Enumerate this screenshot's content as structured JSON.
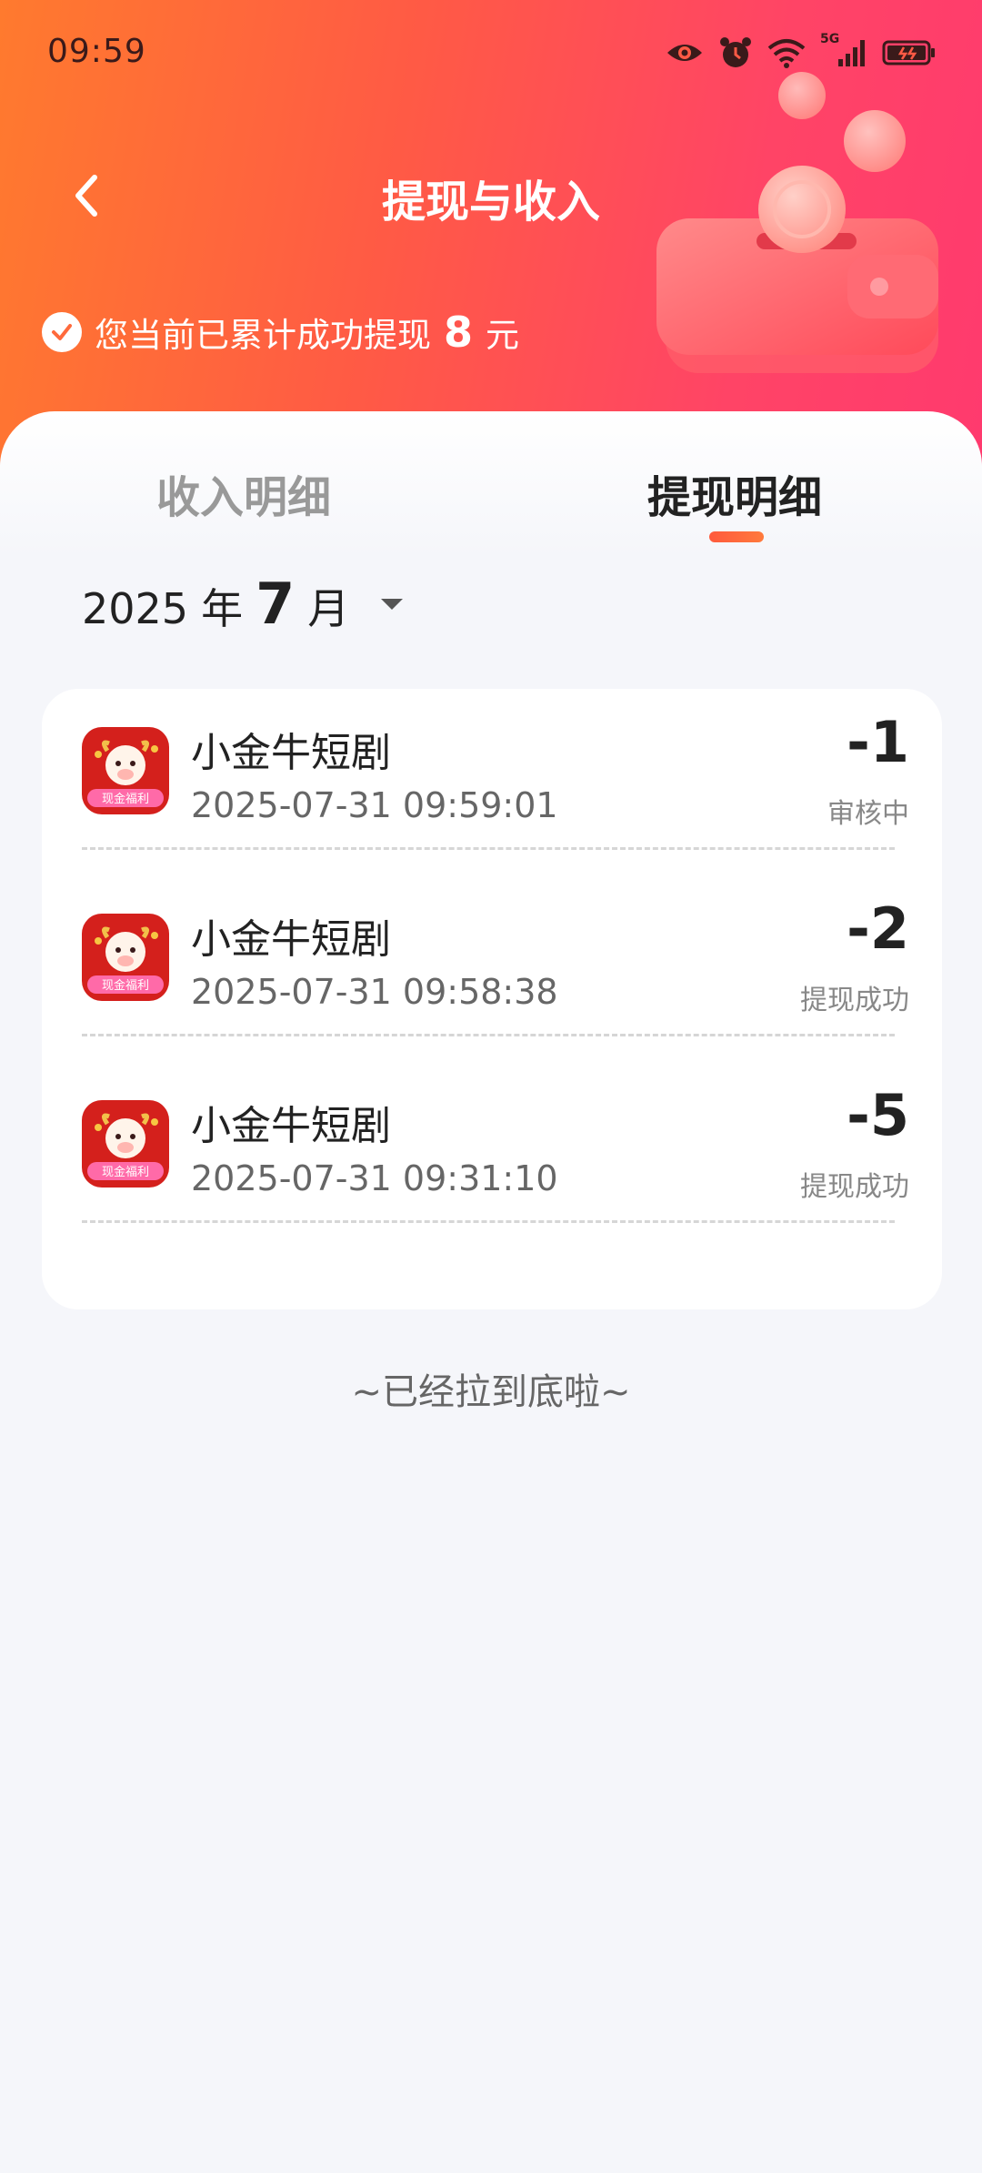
{
  "status_bar": {
    "time": "09:59",
    "network_label": "5G"
  },
  "header": {
    "title": "提现与收入",
    "summary_prefix": "您当前已累计成功提现",
    "summary_amount": "8",
    "summary_unit": "元"
  },
  "tabs": [
    {
      "label": "收入明细",
      "active": false
    },
    {
      "label": "提现明细",
      "active": true
    }
  ],
  "month_selector": {
    "year": "2025",
    "year_unit": "年",
    "month": "7",
    "month_unit": "月"
  },
  "records": [
    {
      "app_name": "小金牛短剧",
      "time": "2025-07-31 09:59:01",
      "amount": "-1",
      "status": "审核中",
      "icon_badge": "现金福利"
    },
    {
      "app_name": "小金牛短剧",
      "time": "2025-07-31 09:58:38",
      "amount": "-2",
      "status": "提现成功",
      "icon_badge": "现金福利"
    },
    {
      "app_name": "小金牛短剧",
      "time": "2025-07-31 09:31:10",
      "amount": "-5",
      "status": "提现成功",
      "icon_badge": "现金福利"
    }
  ],
  "end_note": "~已经拉到底啦~",
  "colors": {
    "header_start": "#ff7a2e",
    "header_end": "#ff3a6e",
    "tab_indicator": "#ff5a3c",
    "background": "#f5f6fa"
  }
}
